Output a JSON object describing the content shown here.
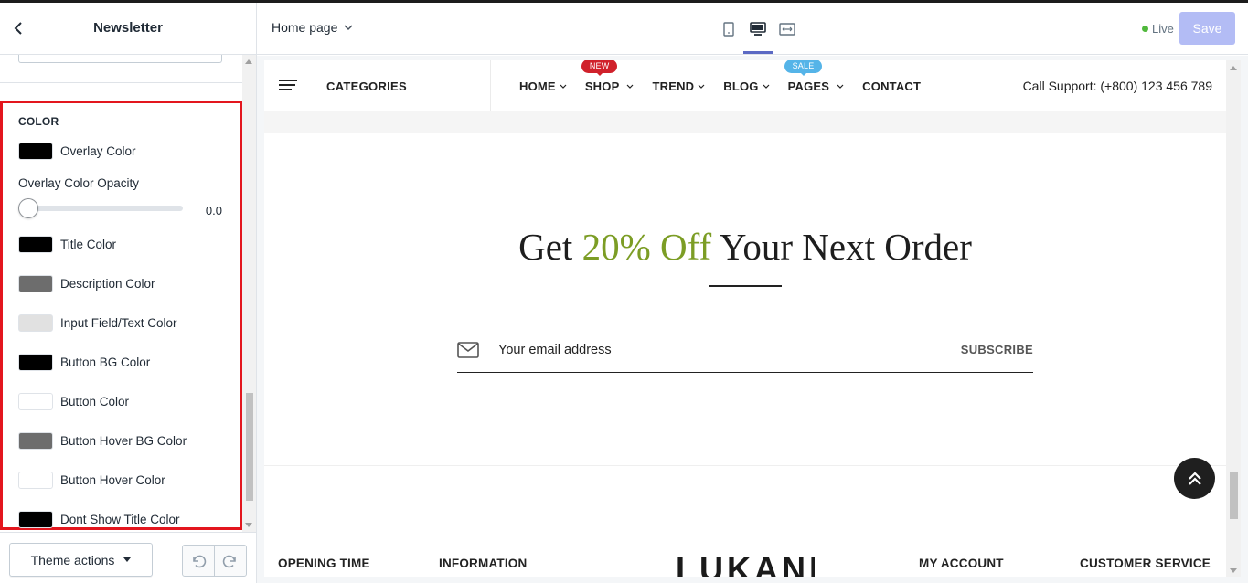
{
  "sidebar": {
    "title": "Newsletter",
    "section_title": "COLOR",
    "opacity_label": "Overlay Color Opacity",
    "opacity_value": "0.0",
    "opacity_fraction": 0.0,
    "colors": [
      {
        "label": "Overlay Color",
        "swatch": "#000000"
      },
      {
        "label": "Title Color",
        "swatch": "#000000"
      },
      {
        "label": "Description Color",
        "swatch": "#6d6d6d"
      },
      {
        "label": "Input Field/Text Color",
        "swatch": "#e1e1e1"
      },
      {
        "label": "Button BG Color",
        "swatch": "#000000"
      },
      {
        "label": "Button Color",
        "swatch": "#ffffff"
      },
      {
        "label": "Button Hover BG Color",
        "swatch": "#6d6d6d"
      },
      {
        "label": "Button Hover Color",
        "swatch": "#ffffff"
      },
      {
        "label": "Dont Show Title Color",
        "swatch": "#000000"
      }
    ],
    "theme_actions_label": "Theme actions",
    "highlight_color": "#e3161e"
  },
  "topbar": {
    "page_select": "Home page",
    "live_label": "Live",
    "save_label": "Save"
  },
  "preview": {
    "categories_label": "CATEGORIES",
    "nav": [
      {
        "label": "HOME",
        "has_chevron": true
      },
      {
        "label": "SHOP",
        "has_chevron": true,
        "badge": "NEW"
      },
      {
        "label": "TREND",
        "has_chevron": true
      },
      {
        "label": "BLOG",
        "has_chevron": true
      },
      {
        "label": "PAGES",
        "has_chevron": true,
        "badge": "SALE"
      },
      {
        "label": "CONTACT",
        "has_chevron": false
      }
    ],
    "support_text": "Call Support: (+800) 123 456 789",
    "headline_pre": "Get ",
    "headline_highlight": "20% Off",
    "headline_post": " Your Next Order",
    "highlight_color": "#7c9d25",
    "email_placeholder": "Your email address",
    "subscribe_label": "SUBSCRIBE",
    "footer_headings": [
      "OPENING TIME",
      "INFORMATION",
      "MY ACCOUNT",
      "CUSTOMER SERVICE"
    ],
    "logo_text": "LUKANI"
  }
}
